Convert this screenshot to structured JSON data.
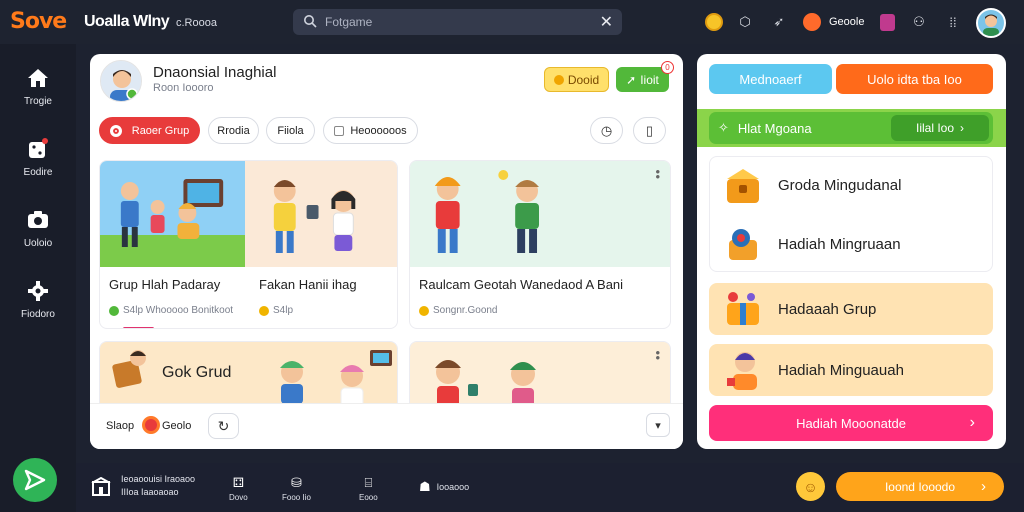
{
  "app": {
    "logo": "Sove",
    "title": "Uoalla Wlny",
    "subtitle": "c.Roooa"
  },
  "search": {
    "placeholder": "Fotgame",
    "clear_icon": "close-icon"
  },
  "topbar": {
    "coin_icon": "coin-icon",
    "label": "Geoole"
  },
  "sidebar": {
    "items": [
      {
        "label": "Trogie",
        "icon": "home-icon"
      },
      {
        "label": "Eodire",
        "icon": "dice-icon"
      },
      {
        "label": "Uoloio",
        "icon": "camera-icon"
      },
      {
        "label": "Fiodoro",
        "icon": "gear-icon"
      }
    ]
  },
  "main": {
    "title": "Dnaonsial Inaghial",
    "subtitle": "Roon Ioooro",
    "gold_button": "Dooid",
    "green_button": "Iioit",
    "green_badge": "0",
    "chips": [
      "Raoer Grup",
      "Rrodia",
      "Fiiola",
      "Heoooooos"
    ],
    "cards": [
      {
        "title": "Grup  Hlah  Padaray",
        "meta": "S4lp  Whooooo Bonitkoot"
      },
      {
        "title": "Fakan  Hanii  ihag",
        "meta": "S4lp"
      },
      {
        "title": "Raulcam  Geotah  Wanedaod  A  Bani",
        "meta": "Songnr.Goond"
      },
      {
        "title": "Gok  Grud",
        "meta": ""
      }
    ],
    "footer": {
      "label": "Slaop",
      "badge": "Geolo"
    }
  },
  "right": {
    "tab1": "Mednoaerf",
    "tab2": "Uolo idta tba Ioo",
    "green_title": "Hlat  Mgoana",
    "green_button": "Iilal Ioo",
    "rewards": [
      "Groda  Mingudanal",
      "Hadiah  Mingruaan",
      "Hadaaah  Grup",
      "Hadiah  Minguauah"
    ],
    "pink_button": "Hadiah  Mooonatde"
  },
  "bottom": {
    "text_line1": "Ieoaoouisi  Iraoaoo",
    "text_line2": "IIIoa  Iaaoaoao",
    "icons": [
      {
        "label": "Dovo",
        "icon": "gamepad-icon"
      },
      {
        "label": "Fooo  Iio",
        "icon": "bag-icon"
      },
      {
        "label": "Eooo",
        "icon": "gift-icon"
      },
      {
        "label": "Iooaooo",
        "icon": "user-icon"
      }
    ],
    "orange_button": "Ioond  Iooodo"
  },
  "colors": {
    "accent_orange": "#ffa41a",
    "accent_green": "#52b83a",
    "accent_red": "#e83b3b",
    "accent_pink": "#ff2f7a",
    "accent_blue": "#5cc8f0"
  }
}
